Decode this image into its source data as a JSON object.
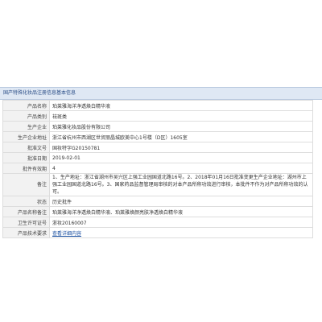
{
  "header": {
    "title": "国产特殊化妆品注册信息基本信息"
  },
  "rows": [
    {
      "label": "产品名称",
      "value": "珀莱雅海洋净透焕白精华液"
    },
    {
      "label": "产品类别",
      "value": "祛斑类"
    },
    {
      "label": "生产企业",
      "value": "珀莱雅化妆品股份有限公司"
    },
    {
      "label": "生产企业地址",
      "value": "浙江省杭州市西湖区世贸丽晶城欧美中心1号楼（D区）1605室"
    },
    {
      "label": "批准文号",
      "value": "国妆特字G20150781"
    },
    {
      "label": "批准日期",
      "value": "2019-02-01"
    },
    {
      "label": "批件有效期",
      "value": "4"
    },
    {
      "label": "备注",
      "value": "1、生产地址：浙江省湖州市吴兴区上强工业园国道北路16号。2、2018年01月16日批准变更生产企业地址：湖州市上强工业园国道北路16号。3、国家药品监督管理局审核的对本产品所称功效进行审核，本批件不作为对产品所称功效的认可。"
    },
    {
      "label": "状态",
      "value": "历史批件"
    },
    {
      "label": "产品名称备注",
      "value": "珀莱雅海洋净透焕白精华液、珀莱雅焕颜亮肤净透焕白精华液"
    },
    {
      "label": "卫生许可证号",
      "value": "浙妆20160007"
    },
    {
      "label": "产品技术要求",
      "value": "查看详细内容"
    }
  ]
}
